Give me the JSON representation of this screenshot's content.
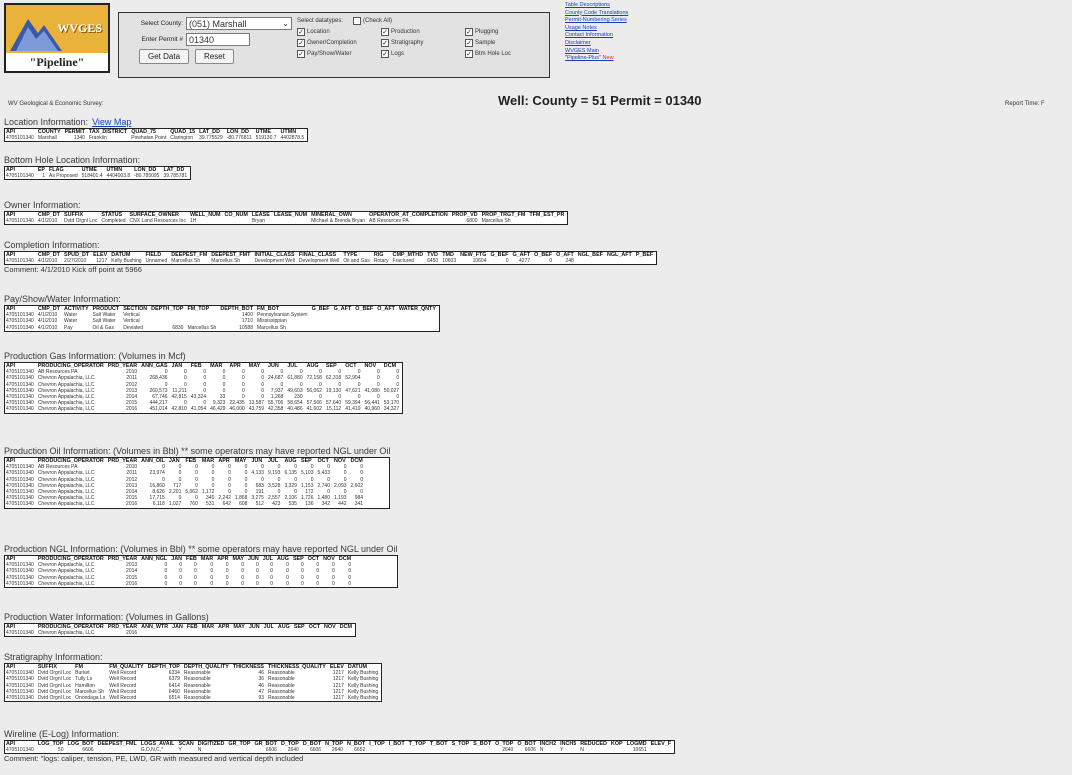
{
  "logo": {
    "text": "WVGES",
    "subtitle": "\"Pipeline\""
  },
  "search": {
    "county_label": "Select County:",
    "county_value": "(051) Marshall",
    "permit_label": "Enter Permit #",
    "permit_value": "01340",
    "get_data_label": "Get Data",
    "reset_label": "Reset",
    "datatypes_label": "Select datatypes:",
    "check_all_label": "(Check All)",
    "datatypes": [
      {
        "label": "Location",
        "checked": true
      },
      {
        "label": "Production",
        "checked": true
      },
      {
        "label": "Plugging",
        "checked": true
      },
      {
        "label": "Owner/Completion",
        "checked": true
      },
      {
        "label": "Stratigraphy",
        "checked": true
      },
      {
        "label": "Sample",
        "checked": true
      },
      {
        "label": "Pay/Show/Water",
        "checked": true
      },
      {
        "label": "Logs",
        "checked": true
      },
      {
        "label": "Btm Hole Loc",
        "checked": true
      }
    ]
  },
  "links": [
    "Table Descriptions",
    "County Code Translations",
    "Permit-Numbering Series",
    "Usage Notes",
    "Contact Information",
    "Disclaimer",
    "WVGES Main",
    "\"Pipeline-Plus\""
  ],
  "links_new_label": "New",
  "header": {
    "survey": "WV Geological & Economic Survey:",
    "well_title": "Well:  County = 51 Permit = 01340",
    "report_time": "Report Time: F"
  },
  "sections": {
    "location": {
      "title": "Location Information:",
      "link": "View Map",
      "headers": [
        "API",
        "COUNTY",
        "PERMIT",
        "TAX_DISTRICT",
        "QUAD_75",
        "QUAD_15",
        "LAT_DD",
        "LON_DD",
        "UTME",
        "UTMN"
      ],
      "rows": [
        [
          "4705101340",
          "Marshall",
          "1340",
          "Franklin",
          "Powhatan Point",
          "Clarington",
          "39.775529",
          "-80.776811",
          "519130.7",
          "4402878.5"
        ]
      ]
    },
    "bottom_hole": {
      "title": "Bottom Hole Location Information:",
      "headers": [
        "API",
        "EP",
        "FLAG",
        "UTME",
        "UTMN",
        "LON_DD",
        "LAT_DD"
      ],
      "rows": [
        [
          "4705101340",
          "1",
          "As Proposed",
          "518401.4",
          "4404003.8",
          "-80.785095",
          "39.785781"
        ]
      ]
    },
    "owner": {
      "title": "Owner Information:",
      "headers": [
        "API",
        "CMP_DT",
        "SUFFIX",
        "STATUS",
        "SURFACE_OWNER",
        "WELL_NUM",
        "CO_NUM",
        "LEASE",
        "LEASE_NUM",
        "MINERAL_OWN",
        "OPERATOR_AT_COMPLETION",
        "PROP_VD",
        "PROP_TRGT_FM",
        "TFM_EST_PR"
      ],
      "rows": [
        [
          "4705101340",
          "4/1/2010",
          "Dvtd Orgnl Loc",
          "Completed",
          "CNX Land Resources Inc",
          "1H",
          "",
          "Bryan",
          "",
          "Michael & Brenda Bryan",
          "AB Resources PA",
          "6800",
          "Marcellus Sh",
          ""
        ]
      ]
    },
    "completion": {
      "title": "Completion Information:",
      "headers": [
        "API",
        "CMP_DT",
        "SPUD_DT",
        "ELEV",
        "DATUM",
        "FIELD",
        "DEEPEST_FM",
        "DEEPEST_FMT",
        "INITIAL_CLASS",
        "FINAL_CLASS",
        "TYPE",
        "RIG",
        "CMP_MTHD",
        "TVD",
        "TMD",
        "NEW_FTG",
        "G_BEF",
        "G_AFT",
        "O_BEF",
        "O_AFT",
        "NGL_BEF",
        "NGL_AFT",
        "P_BEF"
      ],
      "rows": [
        [
          "4705101340",
          "4/1/2010",
          "2/27/2010",
          "1217",
          "Kelly Bushing",
          "Unnamed",
          "Marcellus Sh",
          "Marcellus Sh",
          "Development Well",
          "Development Well",
          "Oil and Gas",
          "Rotary",
          "Fractured",
          "6450",
          "10603",
          "10604",
          "0",
          "4277",
          "0",
          "248",
          "",
          "",
          ""
        ]
      ],
      "comment": "Comment:  4/1/2010  Kick off point at 5966"
    },
    "pay": {
      "title": "Pay/Show/Water Information:",
      "headers": [
        "API",
        "CMP_DT",
        "ACTIVITY",
        "PRODUCT",
        "SECTION",
        "DEPTH_TOP",
        "FM_TOP",
        "DEPTH_BOT",
        "FM_BOT",
        "G_BEF",
        "G_AFT",
        "O_BEF",
        "O_AFT",
        "WATER_QNTY"
      ],
      "rows": [
        [
          "4705101340",
          "4/1/2010",
          "Water",
          "Salt Water",
          "Vertical",
          "",
          "",
          "1400",
          "Pennsylvanian System",
          "",
          "",
          "",
          "",
          ""
        ],
        [
          "4705101340",
          "4/1/2010",
          "Water",
          "Salt Water",
          "Vertical",
          "",
          "",
          "1710",
          "Mississippian",
          "",
          "",
          "",
          "",
          ""
        ],
        [
          "4705101340",
          "4/1/2010",
          "Pay",
          "Oil & Gas",
          "Deviated",
          "6830",
          "Marcellus Sh",
          "10588",
          "Marcellus Sh",
          "",
          "",
          "",
          "",
          ""
        ]
      ]
    },
    "gas": {
      "title": "Production Gas Information: (Volumes in Mcf)",
      "headers": [
        "API",
        "PRODUCING_OPERATOR",
        "PRD_YEAR",
        "ANN_GAS",
        "JAN",
        "FEB",
        "MAR",
        "APR",
        "MAY",
        "JUN",
        "JUL",
        "AUG",
        "SEP",
        "OCT",
        "NOV",
        "DCM"
      ],
      "rows": [
        [
          "4705101340",
          "AB Resources PA",
          "2010",
          "0",
          "0",
          "0",
          "0",
          "0",
          "0",
          "0",
          "0",
          "0",
          "0",
          "0",
          "0",
          "0"
        ],
        [
          "4705101340",
          "Chevron Appalachia, LLC",
          "2011",
          "268,436",
          "0",
          "0",
          "0",
          "0",
          "0",
          "24,687",
          "61,880",
          "72,158",
          "62,318",
          "52,904",
          "0",
          "0"
        ],
        [
          "4705101340",
          "Chevron Appalachia, LLC",
          "2012",
          "0",
          "0",
          "0",
          "0",
          "0",
          "0",
          "0",
          "0",
          "0",
          "0",
          "0",
          "0",
          "0"
        ],
        [
          "4705101340",
          "Chevron Appalachia, LLC",
          "2013",
          "260,573",
          "11,211",
          "0",
          "0",
          "0",
          "0",
          "7,937",
          "49,603",
          "56,062",
          "19,130",
          "47,621",
          "41,080",
          "50,027"
        ],
        [
          "4705101340",
          "Chevron Appalachia, LLC",
          "2014",
          "67,746",
          "42,815",
          "43,324",
          "33",
          "0",
          "0",
          "1,268",
          "230",
          "0",
          "0",
          "0",
          "0",
          "0"
        ],
        [
          "4705101340",
          "Chevron Appalachia, LLC",
          "2015",
          "444,217",
          "0",
          "0",
          "9,323",
          "22,435",
          "13,587",
          "55,706",
          "58,654",
          "57,566",
          "57,640",
          "59,394",
          "56,441",
          "53,170"
        ],
        [
          "4705101340",
          "Chevron Appalachia, LLC",
          "2016",
          "451,014",
          "42,810",
          "41,054",
          "46,429",
          "46,000",
          "43,759",
          "42,358",
          "40,486",
          "41,602",
          "15,112",
          "41,419",
          "40,960",
          "34,327"
        ]
      ]
    },
    "oil": {
      "title": "Production Oil Information: (Volumes in Bbl)  ** some operators may have reported NGL under Oil",
      "headers": [
        "API",
        "PRODUCING_OPERATOR",
        "PRD_YEAR",
        "ANN_OIL",
        "JAN",
        "FEB",
        "MAR",
        "APR",
        "MAY",
        "JUN",
        "JUL",
        "AUG",
        "SEP",
        "OCT",
        "NOV",
        "DCM"
      ],
      "rows": [
        [
          "4705101340",
          "AB Resources PA",
          "2010",
          "0",
          "0",
          "0",
          "0",
          "0",
          "0",
          "0",
          "0",
          "0",
          "0",
          "0",
          "0",
          "0"
        ],
        [
          "4705101340",
          "Chevron Appalachia, LLC",
          "2011",
          "23,974",
          "0",
          "0",
          "0",
          "0",
          "0",
          "4,133",
          "9,193",
          "6,135",
          "5,103",
          "5,433",
          "0",
          "0"
        ],
        [
          "4705101340",
          "Chevron Appalachia, LLC",
          "2012",
          "0",
          "0",
          "0",
          "0",
          "0",
          "0",
          "0",
          "0",
          "0",
          "0",
          "0",
          "0",
          "0"
        ],
        [
          "4705101340",
          "Chevron Appalachia, LLC",
          "2013",
          "16,860",
          "717",
          "0",
          "0",
          "0",
          "0",
          "683",
          "3,528",
          "3,329",
          "1,153",
          "2,740",
          "2,093",
          "2,602"
        ],
        [
          "4705101340",
          "Chevron Appalachia, LLC",
          "2014",
          "8,626",
          "2,201",
          "5,062",
          "1,172",
          "0",
          "0",
          "191",
          "0",
          "0",
          "172",
          "0",
          "0",
          "0"
        ],
        [
          "4705101340",
          "Chevron Appalachia, LLC",
          "2015",
          "17,715",
          "0",
          "0",
          "340",
          "2,242",
          "1,868",
          "3,275",
          "2,557",
          "2,106",
          "1,726",
          "1,480",
          "1,193",
          "984"
        ],
        [
          "4705101340",
          "Chevron Appalachia, LLC",
          "2016",
          "6,118",
          "1,027",
          "760",
          "531",
          "642",
          "608",
          "512",
          "423",
          "535",
          "136",
          "342",
          "442",
          "341"
        ]
      ]
    },
    "ngl": {
      "title": "Production NGL Information: (Volumes in Bbl)  ** some operators may have reported NGL under Oil",
      "headers": [
        "API",
        "PRODUCING_OPERATOR",
        "PRD_YEAR",
        "ANN_NGL",
        "JAN",
        "FEB",
        "MAR",
        "APR",
        "MAY",
        "JUN",
        "JUL",
        "AUG",
        "SEP",
        "OCT",
        "NOV",
        "DCM"
      ],
      "rows": [
        [
          "4705101340",
          "Chevron Appalachia, LLC",
          "2013",
          "0",
          "0",
          "0",
          "0",
          "0",
          "0",
          "0",
          "0",
          "0",
          "0",
          "0",
          "0",
          "0"
        ],
        [
          "4705101340",
          "Chevron Appalachia, LLC",
          "2014",
          "0",
          "0",
          "0",
          "0",
          "0",
          "0",
          "0",
          "0",
          "0",
          "0",
          "0",
          "0",
          "0"
        ],
        [
          "4705101340",
          "Chevron Appalachia, LLC",
          "2015",
          "0",
          "0",
          "0",
          "0",
          "0",
          "0",
          "0",
          "0",
          "0",
          "0",
          "0",
          "0",
          "0"
        ],
        [
          "4705101340",
          "Chevron Appalachia, LLC",
          "2016",
          "0",
          "0",
          "0",
          "0",
          "0",
          "0",
          "0",
          "0",
          "0",
          "0",
          "0",
          "0",
          "0"
        ]
      ]
    },
    "water": {
      "title": "Production Water Information: (Volumes in Gallons)",
      "headers": [
        "API",
        "PRODUCING_OPERATOR",
        "PRD_YEAR",
        "ANN_WTR",
        "JAN",
        "FEB",
        "MAR",
        "APR",
        "MAY",
        "JUN",
        "JUL",
        "AUG",
        "SEP",
        "OCT",
        "NOV",
        "DCM"
      ],
      "rows": [
        [
          "4705101340",
          "Chevron Appalachia, LLC",
          "2016",
          "",
          "",
          "",
          "",
          "",
          "",
          "",
          "",
          "",
          "",
          "",
          "",
          ""
        ]
      ]
    },
    "strat": {
      "title": "Stratigraphy Information:",
      "headers": [
        "API",
        "SUFFIX",
        "FM",
        "FM_QUALITY",
        "DEPTH_TOP",
        "DEPTH_QUALITY",
        "THICKNESS",
        "THICKNESS_QUALITY",
        "ELEV",
        "DATUM"
      ],
      "rows": [
        [
          "4705101340",
          "Dvtd Orgnl Loc",
          "Burket",
          "Well Record",
          "6334",
          "Reasonable",
          "46",
          "Reasonable",
          "1217",
          "Kelly Bushing"
        ],
        [
          "4705101340",
          "Dvtd Orgnl Loc",
          "Tully Ls",
          "Well Record",
          "6379",
          "Reasonable",
          "36",
          "Reasonable",
          "1217",
          "Kelly Bushing"
        ],
        [
          "4705101340",
          "Dvtd Orgnl Loc",
          "Hamilton",
          "Well Record",
          "6414",
          "Reasonable",
          "46",
          "Reasonable",
          "1217",
          "Kelly Bushing"
        ],
        [
          "4705101340",
          "Dvtd Orgnl Loc",
          "Marcellus Sh",
          "Well Record",
          "6460",
          "Reasonable",
          "47",
          "Reasonable",
          "1217",
          "Kelly Bushing"
        ],
        [
          "4705101340",
          "Dvtd Orgnl Loc",
          "Onondaga Ls",
          "Well Record",
          "6514",
          "Reasonable",
          "93",
          "Reasonable",
          "1217",
          "Kelly Bushing"
        ]
      ]
    },
    "wireline": {
      "title": "Wireline (E-Log) Information:",
      "headers": [
        "API",
        "LOG_TOP",
        "LOG_BOT",
        "DEEPEST_FML",
        "LOGS_AVAIL",
        "SCAN",
        "DIGITIZED",
        "GR_TOP",
        "GR_BOT",
        "D_TOP",
        "D_BOT",
        "N_TOP",
        "N_BOT",
        "I_TOP",
        "I_BOT",
        "T_TOP",
        "T_BOT",
        "S_TOP",
        "S_BOT",
        "O_TOP",
        "O_BOT",
        "INCH2",
        "INCH5",
        "REDUCED",
        "KOP",
        "LOGMD",
        "ELEV_F"
      ],
      "rows": [
        [
          "4705101340",
          "50",
          "6606",
          "",
          "G,D,N,C,*",
          "Y",
          "N",
          "",
          "6606",
          "2640",
          "6606",
          "2640",
          "6652",
          "",
          "",
          "",
          "",
          "",
          "",
          "2640",
          "6606",
          "N",
          "Y",
          "N",
          "",
          "10651",
          ""
        ]
      ],
      "comment": "Comment:  \"logs: caliper, tension, PE, LWD, GR with measured and vertical depth included"
    }
  }
}
